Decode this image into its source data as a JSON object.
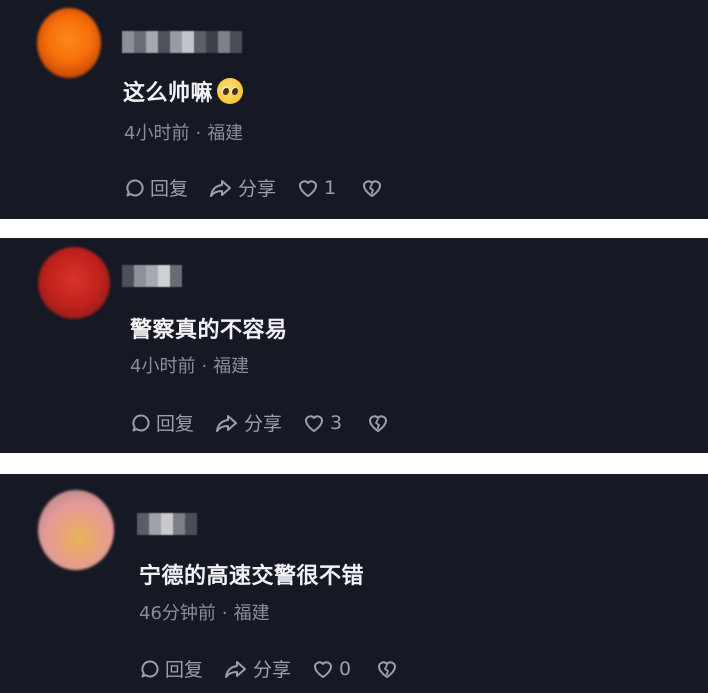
{
  "comments": [
    {
      "text": "这么帅嘛",
      "emoji": "pleading-face-emoji",
      "time": "4小时前",
      "separator": "·",
      "location": "福建",
      "reply_label": "回复",
      "share_label": "分享",
      "like_count": "1",
      "avatar_color": "#f56d0a"
    },
    {
      "text": "警察真的不容易",
      "time": "4小时前",
      "separator": "·",
      "location": "福建",
      "reply_label": "回复",
      "share_label": "分享",
      "like_count": "3",
      "avatar_color": "#c0221c"
    },
    {
      "text": "宁德的高速交警很不错",
      "time": "46分钟前",
      "separator": "·",
      "location": "福建",
      "reply_label": "回复",
      "share_label": "分享",
      "like_count": "0",
      "avatar_color": "#e49a9a"
    }
  ],
  "colors": {
    "card_background": "#161824",
    "comment_text": "#f2f2f4",
    "meta_text": "#8a8c96",
    "action_text": "#9c9ea8",
    "page_background": "#ffffff"
  }
}
